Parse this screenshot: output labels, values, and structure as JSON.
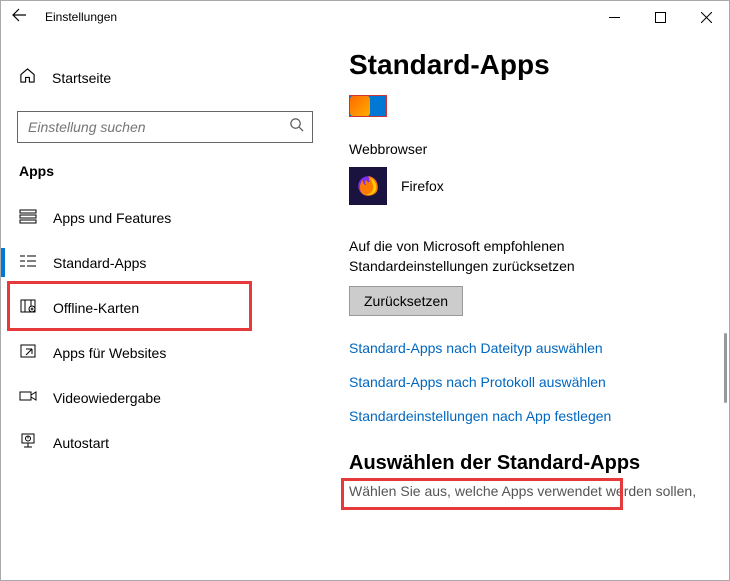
{
  "titlebar": {
    "title": "Einstellungen"
  },
  "sidebar": {
    "home": "Startseite",
    "search_placeholder": "Einstellung suchen",
    "group": "Apps",
    "items": [
      {
        "label": "Apps und Features"
      },
      {
        "label": "Standard-Apps"
      },
      {
        "label": "Offline-Karten"
      },
      {
        "label": "Apps für Websites"
      },
      {
        "label": "Videowiedergabe"
      },
      {
        "label": "Autostart"
      }
    ]
  },
  "main": {
    "title": "Standard-Apps",
    "webbrowser_label": "Webbrowser",
    "browser_name": "Firefox",
    "reset_text": "Auf die von Microsoft empfohlenen Standardeinstellungen zurücksetzen",
    "reset_button": "Zurücksetzen",
    "link1": "Standard-Apps nach Dateityp auswählen",
    "link2": "Standard-Apps nach Protokoll auswählen",
    "link3": "Standardeinstellungen nach App festlegen",
    "subheading": "Auswählen der Standard-Apps",
    "subtext": "Wählen Sie aus, welche Apps verwendet werden sollen,"
  }
}
